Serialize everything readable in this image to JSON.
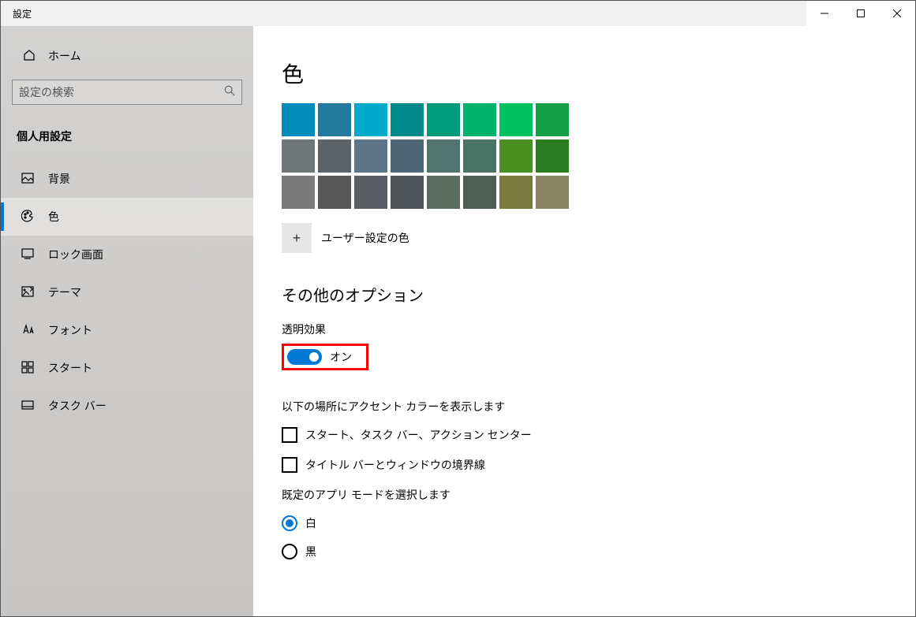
{
  "window": {
    "title": "設定"
  },
  "sidebar": {
    "home_label": "ホーム",
    "search_placeholder": "設定の検索",
    "category": "個人用設定",
    "items": [
      {
        "id": "background",
        "label": "背景"
      },
      {
        "id": "colors",
        "label": "色"
      },
      {
        "id": "lockscreen",
        "label": "ロック画面"
      },
      {
        "id": "themes",
        "label": "テーマ"
      },
      {
        "id": "fonts",
        "label": "フォント"
      },
      {
        "id": "start",
        "label": "スタート"
      },
      {
        "id": "taskbar",
        "label": "タスク バー"
      }
    ]
  },
  "content": {
    "title": "色",
    "swatches": [
      [
        "#008cba",
        "#1f7a9c",
        "#00aacc",
        "#008a8a",
        "#009c7a",
        "#00b26b",
        "#00c060",
        "#14a046"
      ],
      [
        "#6f7779",
        "#5c636b",
        "#5e7589",
        "#4e6675",
        "#52746e",
        "#4a7366",
        "#498f22",
        "#2a7a1f"
      ],
      [
        "#7a7a7a",
        "#565656",
        "#5a5d66",
        "#4f5459",
        "#5a6b5f",
        "#4f5e54",
        "#7a7a3f",
        "#8a8362"
      ]
    ],
    "custom_color_label": "ユーザー設定の色",
    "other_options_header": "その他のオプション",
    "transparency_label": "透明効果",
    "toggle_state_label": "オン",
    "accent_heading": "以下の場所にアクセント カラーを表示します",
    "checkboxes": [
      {
        "label": "スタート、タスク バー、アクション センター",
        "checked": false
      },
      {
        "label": "タイトル バーとウィンドウの境界線",
        "checked": false
      }
    ],
    "mode_heading": "既定のアプリ モードを選択します",
    "radios": [
      {
        "label": "白",
        "checked": true
      },
      {
        "label": "黒",
        "checked": false
      }
    ]
  }
}
